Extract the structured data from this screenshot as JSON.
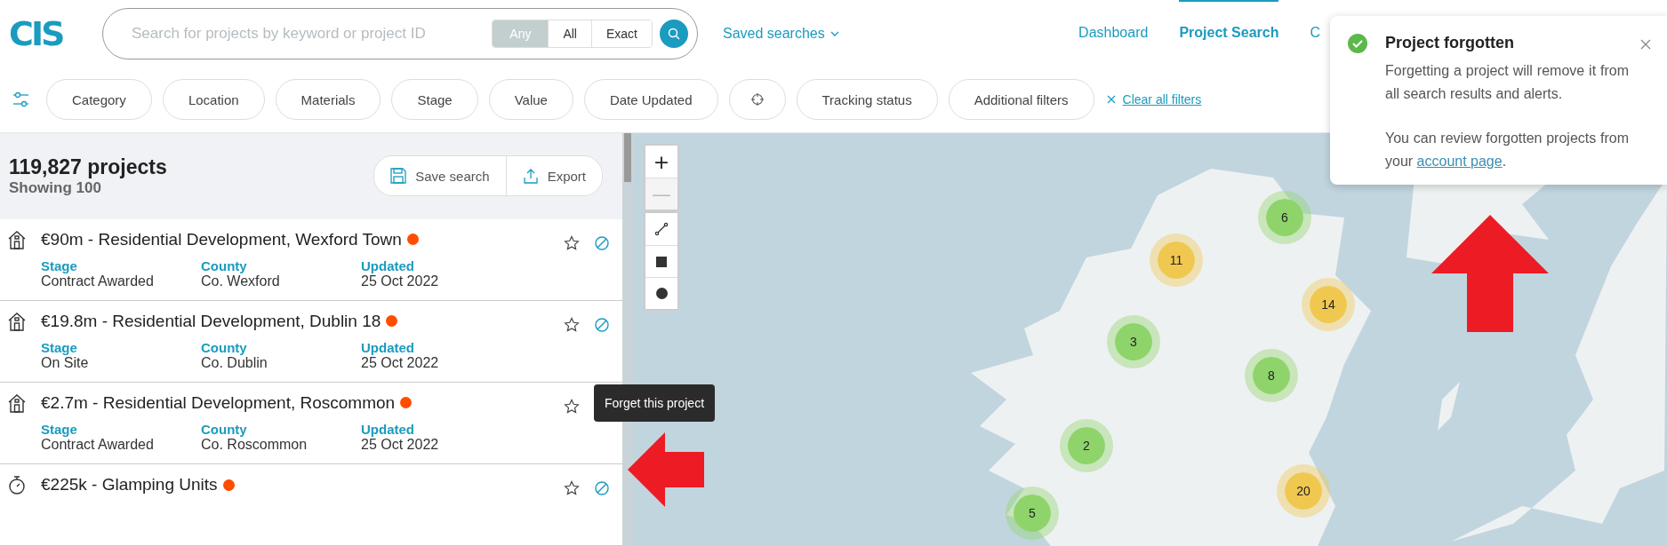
{
  "logo": "CIS",
  "search": {
    "placeholder": "Search for projects by keyword or project ID",
    "modes": [
      {
        "label": "Any",
        "selected": true
      },
      {
        "label": "All",
        "selected": false
      },
      {
        "label": "Exact",
        "selected": false
      }
    ]
  },
  "saved_searches": "Saved searches",
  "nav": [
    {
      "label": "Dashboard",
      "selected": false
    },
    {
      "label": "Project Search",
      "selected": true
    },
    {
      "label": "C",
      "selected": false
    }
  ],
  "filters": [
    {
      "kind": "text",
      "label": "Category"
    },
    {
      "kind": "text",
      "label": "Location"
    },
    {
      "kind": "text",
      "label": "Materials"
    },
    {
      "kind": "text",
      "label": "Stage"
    },
    {
      "kind": "text",
      "label": "Value"
    },
    {
      "kind": "text",
      "label": "Date Updated"
    },
    {
      "kind": "icon"
    },
    {
      "kind": "text",
      "label": "Tracking status"
    },
    {
      "kind": "text",
      "label": "Additional filters"
    }
  ],
  "clear_filters": "Clear all filters",
  "results": {
    "count": "119,827 projects",
    "showing": "Showing 100",
    "actions": [
      {
        "kind": "save",
        "label": "Save search"
      },
      {
        "kind": "export",
        "label": "Export"
      }
    ]
  },
  "projects": [
    {
      "kind": "house",
      "title": "€90m - Residential Development, Wexford Town",
      "fields": [
        {
          "label": "Stage",
          "value": "Contract Awarded"
        },
        {
          "label": "County",
          "value": "Co. Wexford"
        },
        {
          "label": "Updated",
          "value": "25 Oct 2022"
        }
      ]
    },
    {
      "kind": "house",
      "title": "€19.8m - Residential Development, Dublin 18",
      "fields": [
        {
          "label": "Stage",
          "value": "On Site"
        },
        {
          "label": "County",
          "value": "Co. Dublin"
        },
        {
          "label": "Updated",
          "value": "25 Oct 2022"
        }
      ]
    },
    {
      "kind": "house",
      "title": "€2.7m - Residential Development, Roscommon",
      "fields": [
        {
          "label": "Stage",
          "value": "Contract Awarded"
        },
        {
          "label": "County",
          "value": "Co. Roscommon"
        },
        {
          "label": "Updated",
          "value": "25 Oct 2022"
        }
      ]
    },
    {
      "kind": "timer",
      "title": "€225k - Glamping Units"
    }
  ],
  "tooltip": "Forget this project",
  "map": {
    "zoom": [
      "+",
      "—"
    ],
    "tools": [
      {
        "kind": "line"
      },
      {
        "kind": "square"
      },
      {
        "kind": "circle"
      }
    ],
    "clusters": [
      {
        "count": "6",
        "color": "#8ed46a"
      },
      {
        "count": "11",
        "color": "#f0c850"
      },
      {
        "count": "14",
        "color": "#f0c850"
      },
      {
        "count": "3",
        "color": "#8ed46a"
      },
      {
        "count": "8",
        "color": "#8ed46a"
      },
      {
        "count": "2",
        "color": "#8ed46a"
      },
      {
        "count": "20",
        "color": "#f0c850"
      },
      {
        "count": "5",
        "color": "#8ed46a"
      }
    ]
  },
  "toast": {
    "title": "Project forgotten",
    "message": "Forgetting a project will remove it from all search results and alerts.",
    "note": "You can review forgotten projects from your ",
    "link": "account page",
    "note_end": "."
  }
}
